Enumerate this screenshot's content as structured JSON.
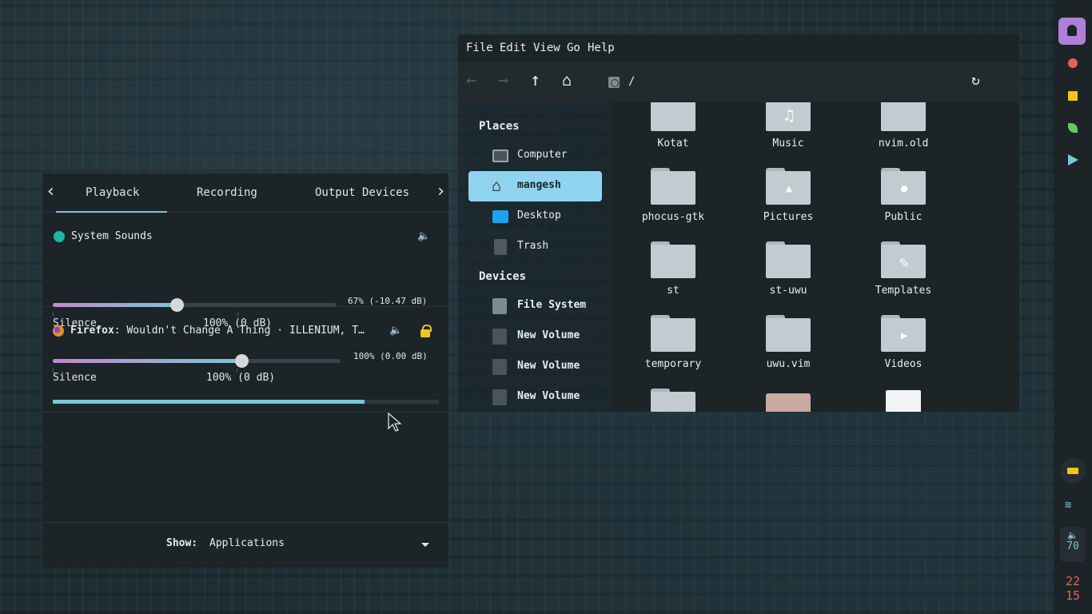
{
  "pavucontrol": {
    "tabs": [
      "Playback",
      "Recording",
      "Output Devices"
    ],
    "active_tab": "Playback",
    "streams": [
      {
        "name": "System Sounds",
        "volume_text": "67% (-10.47 dB)",
        "volume_fraction": 0.436,
        "marks": [
          "Silence",
          "100% (0 dB)"
        ],
        "icon": "speaker-icon",
        "icon_color": "#1fb5a4"
      },
      {
        "app": "Firefox",
        "media": ": Wouldn't Change A Thing · ILLENIUM, T…",
        "volume_text": "100% (0.00 dB)",
        "volume_fraction": 0.655,
        "marks": [
          "Silence",
          "100% (0 dB)"
        ],
        "meter_fraction": 0.808,
        "icon": "firefox-icon",
        "icon_color": "#f08a24"
      }
    ],
    "show_label": "Show:",
    "show_value": "Applications"
  },
  "filemanager": {
    "menu": [
      "File",
      "Edit",
      "View",
      "Go",
      "Help"
    ],
    "path": "/",
    "places_header": "Places",
    "places": [
      {
        "label": "Computer",
        "icon": "computer-icon"
      },
      {
        "label": "mangesh",
        "icon": "home-icon"
      },
      {
        "label": "Desktop",
        "icon": "desktop-icon"
      },
      {
        "label": "Trash",
        "icon": "trash-icon"
      }
    ],
    "devices_header": "Devices",
    "devices": [
      {
        "label": "File System",
        "icon": "drive-icon"
      },
      {
        "label": "New Volume",
        "icon": "drive-icon"
      },
      {
        "label": "New Volume",
        "icon": "drive-icon"
      },
      {
        "label": "New Volume",
        "icon": "drive-icon"
      }
    ],
    "folders": [
      {
        "name": "Kotat",
        "emblem": ""
      },
      {
        "name": "Music",
        "emblem": "♫"
      },
      {
        "name": "nvim.old",
        "emblem": ""
      },
      {
        "name": "phocus-gtk",
        "emblem": ""
      },
      {
        "name": "Pictures",
        "emblem": "▲"
      },
      {
        "name": "Public",
        "emblem": "●"
      },
      {
        "name": "st",
        "emblem": ""
      },
      {
        "name": "st-uwu",
        "emblem": ""
      },
      {
        "name": "Templates",
        "emblem": "✎"
      },
      {
        "name": "temporary",
        "emblem": ""
      },
      {
        "name": "uwu.vim",
        "emblem": ""
      },
      {
        "name": "Videos",
        "emblem": "▶"
      }
    ]
  },
  "rightbar": {
    "apps": [
      "firefox-icon",
      "folder-icon",
      "leaf-icon",
      "telegram-icon"
    ],
    "app_colors": [
      "#e8615a",
      "#f5c518",
      "#6cc36c",
      "#78c7d7"
    ],
    "volume": "70",
    "clock_hour": "22",
    "clock_minute": "15",
    "battery_icon": "battery-icon",
    "wifi_icon": "wifi-icon"
  }
}
